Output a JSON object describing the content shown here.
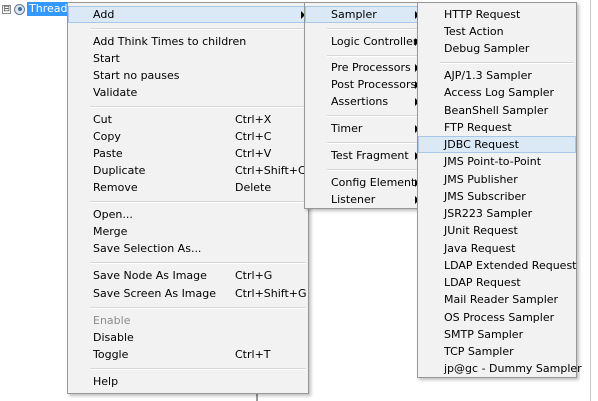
{
  "tree": {
    "node_label": "Thread",
    "expander": "⊟"
  },
  "context_menu": {
    "items": [
      {
        "label": "Add",
        "shortcut": "",
        "submenu": true,
        "disabled": false,
        "highlighted": true
      },
      {
        "label": "Add Think Times to children",
        "shortcut": ""
      },
      {
        "label": "Start",
        "shortcut": ""
      },
      {
        "label": "Start no pauses",
        "shortcut": ""
      },
      {
        "label": "Validate",
        "shortcut": ""
      },
      {
        "label": "Cut",
        "shortcut": "Ctrl+X"
      },
      {
        "label": "Copy",
        "shortcut": "Ctrl+C"
      },
      {
        "label": "Paste",
        "shortcut": "Ctrl+V"
      },
      {
        "label": "Duplicate",
        "shortcut": "Ctrl+Shift+C"
      },
      {
        "label": "Remove",
        "shortcut": "Delete"
      },
      {
        "label": "Open...",
        "shortcut": ""
      },
      {
        "label": "Merge",
        "shortcut": ""
      },
      {
        "label": "Save Selection As...",
        "shortcut": ""
      },
      {
        "label": "Save Node As Image",
        "shortcut": "Ctrl+G"
      },
      {
        "label": "Save Screen As Image",
        "shortcut": "Ctrl+Shift+G"
      },
      {
        "label": "Enable",
        "shortcut": "",
        "disabled": true
      },
      {
        "label": "Disable",
        "shortcut": ""
      },
      {
        "label": "Toggle",
        "shortcut": "Ctrl+T"
      },
      {
        "label": "Help",
        "shortcut": ""
      }
    ]
  },
  "add_submenu": {
    "items": [
      {
        "label": "Sampler",
        "submenu": true,
        "highlighted": true
      },
      {
        "label": "Logic Controller",
        "submenu": true
      },
      {
        "label": "Pre Processors",
        "submenu": true
      },
      {
        "label": "Post Processors",
        "submenu": true
      },
      {
        "label": "Assertions",
        "submenu": true
      },
      {
        "label": "Timer",
        "submenu": true
      },
      {
        "label": "Test Fragment",
        "submenu": true
      },
      {
        "label": "Config Element",
        "submenu": true
      },
      {
        "label": "Listener",
        "submenu": true
      }
    ]
  },
  "sampler_submenu": {
    "items": [
      {
        "label": "HTTP Request"
      },
      {
        "label": "Test Action"
      },
      {
        "label": "Debug Sampler"
      },
      {
        "label": "AJP/1.3 Sampler"
      },
      {
        "label": "Access Log Sampler"
      },
      {
        "label": "BeanShell Sampler"
      },
      {
        "label": "FTP Request"
      },
      {
        "label": "JDBC Request",
        "highlighted": true
      },
      {
        "label": "JMS Point-to-Point"
      },
      {
        "label": "JMS Publisher"
      },
      {
        "label": "JMS Subscriber"
      },
      {
        "label": "JSR223 Sampler"
      },
      {
        "label": "JUnit Request"
      },
      {
        "label": "Java Request"
      },
      {
        "label": "LDAP Extended Request"
      },
      {
        "label": "LDAP Request"
      },
      {
        "label": "Mail Reader Sampler"
      },
      {
        "label": "OS Process Sampler"
      },
      {
        "label": "SMTP Sampler"
      },
      {
        "label": "TCP Sampler"
      },
      {
        "label": "jp@gc - Dummy Sampler"
      }
    ]
  },
  "colors": {
    "selection": "#3399ff",
    "menu_background": "#f2f2f2",
    "hover_background": "#dbe9f7",
    "disabled_text": "#8c8c8c"
  }
}
